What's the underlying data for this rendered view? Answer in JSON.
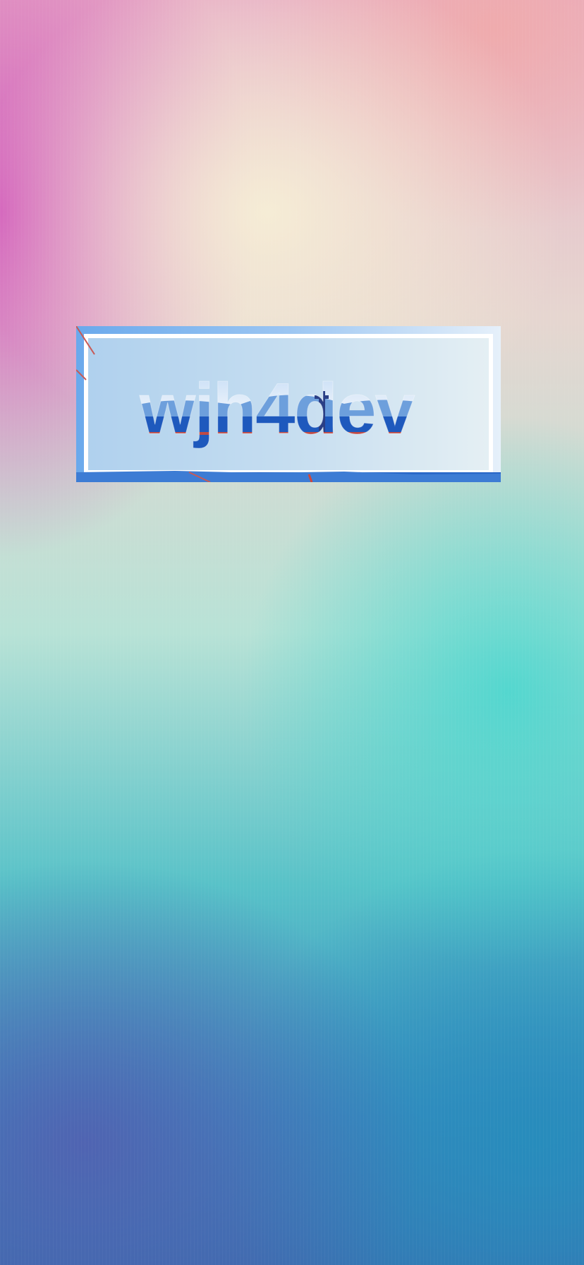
{
  "wallpaper": {
    "colors": {
      "top_left": "#c94ab6",
      "top_center": "#f2e6d6",
      "top_right": "#eab2b8",
      "middle_right": "#56d0c8",
      "bottom_left": "#5060b0",
      "bottom_right": "#2a82bc"
    }
  },
  "logo": {
    "text": "wjh4dev",
    "frame_color": "#ffffff",
    "fill_colors": {
      "sky": "#eaf2fb",
      "mountains": "#5a90d6",
      "water": "#1f5fbf",
      "bridge": "#d0463a"
    }
  }
}
